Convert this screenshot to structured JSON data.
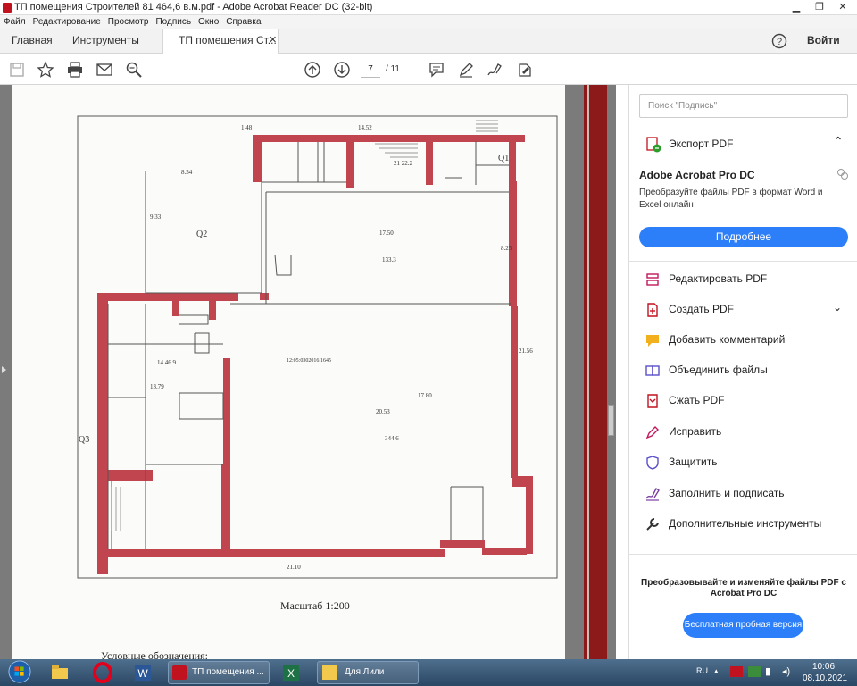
{
  "window": {
    "title": "ТП помещения Строителей 81 464,6 в.м.pdf - Adobe Acrobat Reader DC (32-bit)"
  },
  "menu": [
    "Файл",
    "Редактирование",
    "Просмотр",
    "Подпись",
    "Окно",
    "Справка"
  ],
  "tabs": {
    "home": "Главная",
    "tools": "Инструменты",
    "document": "ТП помещения Ст..."
  },
  "signin": "Войти",
  "toolbar": {
    "current_page": "7",
    "total_pages": "/ 11"
  },
  "document": {
    "scale_label": "Масштаб  1:200",
    "legend_heading": "Условные обозначения:",
    "plan_labels": {
      "total_top": "14.52",
      "left_top": "1.48",
      "room_2_area": "344.6",
      "room_2_dim": "20.53",
      "room_24_area": "133.3",
      "room_24_dim": "17.50",
      "q2": "Q2",
      "q1": "Q1",
      "q3": "Q3",
      "bottom_dim": "21.10",
      "dim_8_54": "8.54",
      "dim_9_33": "9.33",
      "dim_13_79": "13.79",
      "dim_21_56": "21.56",
      "dim_17_80": "17.80",
      "dim_8_25": "8.25",
      "room_14": "14 46.9",
      "room_21": "21 22.2",
      "code": "12:05:0302016:1645"
    }
  },
  "panel": {
    "search_placeholder": "Поиск \"Подпись\"",
    "export_label": "Экспорт PDF",
    "pro_title": "Adobe Acrobat Pro DC",
    "pro_desc": "Преобразуйте файлы PDF в формат Word и Excel онлайн",
    "more_button": "Подробнее",
    "tools": [
      "Редактировать PDF",
      "Создать PDF",
      "Добавить комментарий",
      "Объединить файлы",
      "Сжать PDF",
      "Исправить",
      "Защитить",
      "Заполнить и подписать",
      "Дополнительные инструменты"
    ],
    "promo_text": "Преобразовывайте и изменяйте файлы PDF с Acrobat Pro DC",
    "trial_button": "Бесплатная пробная версия"
  },
  "taskbar": {
    "acrobat_button": "ТП помещения ...",
    "folder_button": "Для Лили",
    "lang": "RU",
    "time": "10:06",
    "date": "08.10.2021"
  },
  "colors": {
    "accent": "#2d7ff9",
    "wall": "#c0454f",
    "title_red": "#c1121f"
  }
}
